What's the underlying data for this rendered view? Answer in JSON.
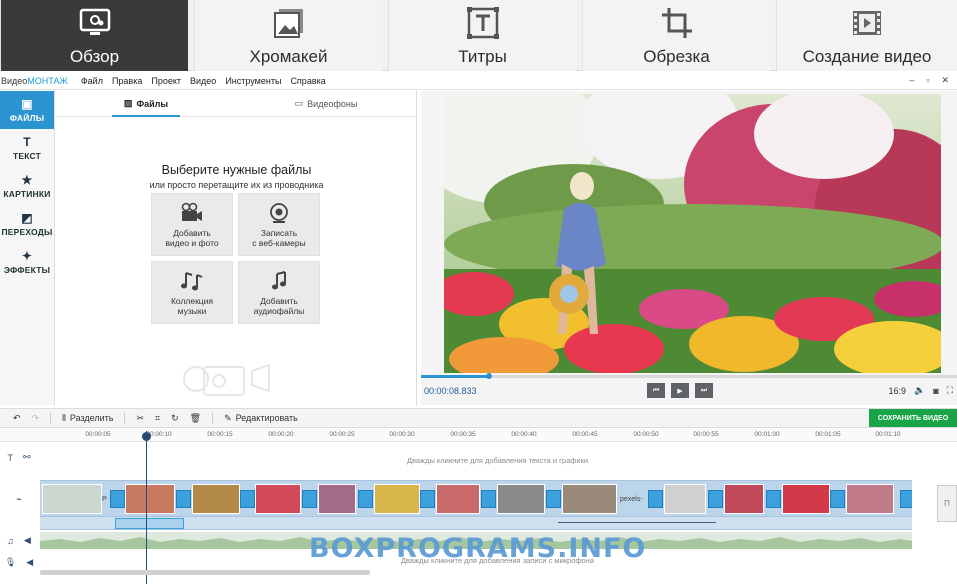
{
  "top_tabs": [
    {
      "label": "Обзор",
      "icon": "overview-icon"
    },
    {
      "label": "Хромакей",
      "icon": "chromakey-icon"
    },
    {
      "label": "Титры",
      "icon": "titles-icon"
    },
    {
      "label": "Обрезка",
      "icon": "crop-icon"
    },
    {
      "label": "Создание видео",
      "icon": "film-icon"
    }
  ],
  "menubar": {
    "brand_a": "Видео",
    "brand_b": "МОНТАЖ",
    "items": [
      "Файл",
      "Правка",
      "Проект",
      "Видео",
      "Инструменты",
      "Справка"
    ]
  },
  "sidenav": [
    {
      "label": "ФАЙЛЫ",
      "icon": "files-icon",
      "active": true
    },
    {
      "label": "ТЕКСТ",
      "icon": "text-icon"
    },
    {
      "label": "КАРТИНКИ",
      "icon": "star-icon"
    },
    {
      "label": "ПЕРЕХОДЫ",
      "icon": "transitions-icon"
    },
    {
      "label": "ЭФФЕКТЫ",
      "icon": "magic-wand-icon"
    }
  ],
  "files_panel": {
    "tab_files": "Файлы",
    "tab_backgrounds": "Видеофоны",
    "heading": "Выберите нужные файлы",
    "subheading": "или просто перетащите их из проводника",
    "tiles": [
      {
        "line1": "Добавить",
        "line2": "видео и фото"
      },
      {
        "line1": "Записать",
        "line2": "с веб-камеры"
      },
      {
        "line1": "Коллекция",
        "line2": "музыки"
      },
      {
        "line1": "Добавить",
        "line2": "аудиофайлы"
      }
    ]
  },
  "preview": {
    "timecode": "00:00:08.833",
    "aspect": "16:9",
    "progress": 0.127
  },
  "edit_toolbar": {
    "split": "Разделить",
    "edit": "Редактировать",
    "save": "СОХРАНИТЬ ВИДЕО"
  },
  "ruler_ticks": [
    "00:00:05",
    "00:00:10",
    "00:00:15",
    "00:00:20",
    "00:00:25",
    "00:00:30",
    "00:00:35",
    "00:00:40",
    "00:00:45",
    "00:00:50",
    "00:00:55",
    "00:01:00",
    "00:01:05",
    "00:01:10"
  ],
  "timeline": {
    "text_hint": "Дважды кликните для добавления текста и графики",
    "audio_hint": "Дважды кликните для добавления записи с микрофона",
    "clip_label": "pexels-",
    "transition_duration": "2.0"
  },
  "watermark": "BOXPROGRAMS.INFO",
  "colors": {
    "accent": "#2a93d0",
    "save": "#19a447",
    "active_tab": "#3a3a3a"
  }
}
